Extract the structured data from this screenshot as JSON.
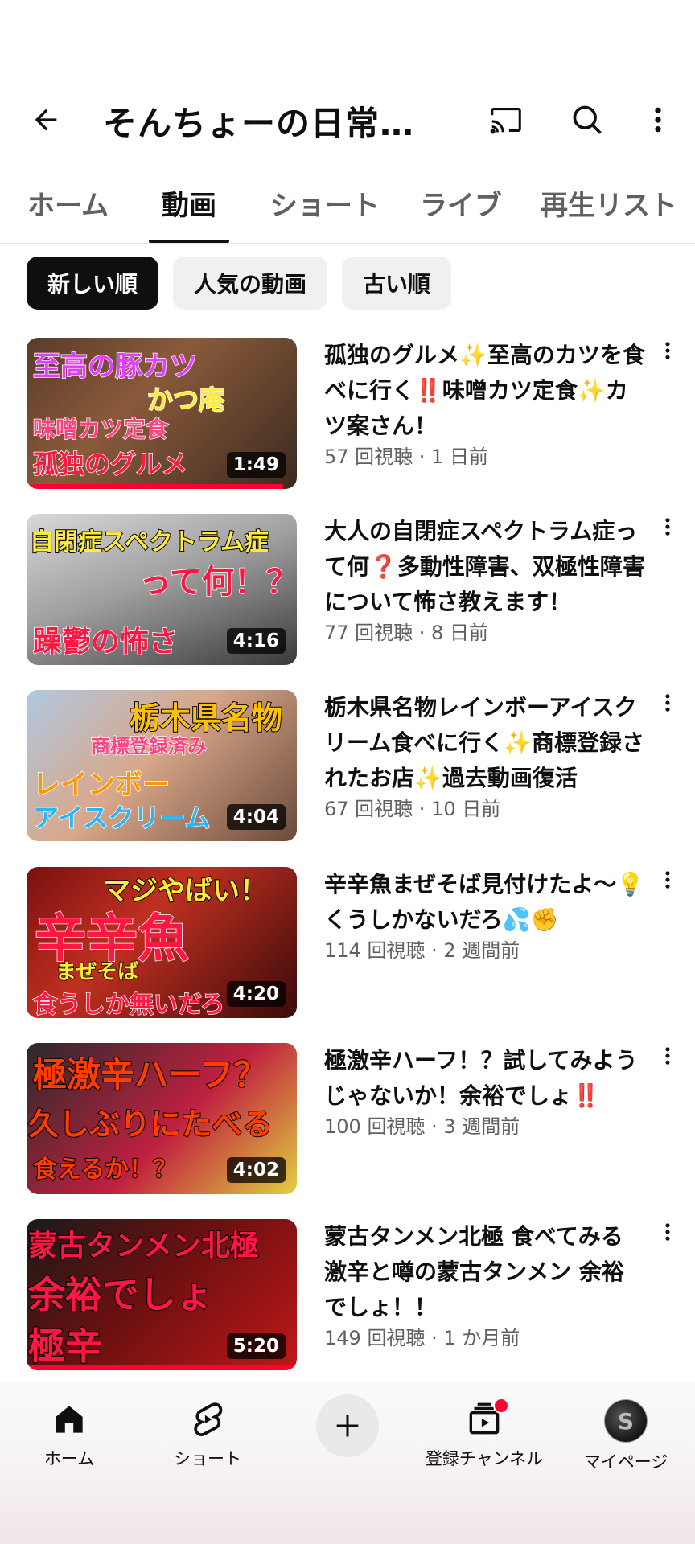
{
  "header": {
    "title": "そんちょーの日常チャンネル",
    "icons": [
      "back-arrow-icon",
      "cast-icon",
      "search-icon",
      "more-vert-icon"
    ]
  },
  "tabs": [
    {
      "label": "ホーム",
      "active": false
    },
    {
      "label": "動画",
      "active": true
    },
    {
      "label": "ショート",
      "active": false
    },
    {
      "label": "ライブ",
      "active": false
    },
    {
      "label": "再生リスト",
      "active": false
    }
  ],
  "chips": [
    {
      "label": "新しい順",
      "active": true
    },
    {
      "label": "人気の動画",
      "active": false
    },
    {
      "label": "古い順",
      "active": false
    }
  ],
  "videos": [
    {
      "title": "孤独のグルメ✨至高のカツを食べに行く‼️味噌カツ定食✨カツ案さん！",
      "meta": "57 回視聴 · 1 日前",
      "duration": "1:49",
      "watched_fraction": 0.95,
      "thumb_lines": [
        "至高の豚カツ",
        "かつ庵",
        "味噌カツ定食",
        "孤独のグルメ"
      ]
    },
    {
      "title": "大人の自閉症スペクトラム症って何❓多動性障害、双極性障害について怖さ教えます！",
      "meta": "77 回視聴 · 8 日前",
      "duration": "4:16",
      "watched_fraction": 0,
      "thumb_lines": [
        "自閉症スペクトラム症",
        "って何！？",
        "躁鬱の怖さ"
      ]
    },
    {
      "title": "栃木県名物レインボーアイスクリーム食べに行く✨商標登録されたお店✨過去動画復活",
      "meta": "67 回視聴 · 10 日前",
      "duration": "4:04",
      "watched_fraction": 0,
      "thumb_lines": [
        "栃木県名物",
        "商標登録済み",
        "レインボー",
        "アイスクリーム"
      ]
    },
    {
      "title": "辛辛魚まぜそば見付けたよ〜💡くうしかないだろ💦✊",
      "meta": "114 回視聴 · 2 週間前",
      "duration": "4:20",
      "watched_fraction": 0,
      "thumb_lines": [
        "マジやばい！",
        "辛辛魚",
        "まぜそば",
        "食うしか無いだろ"
      ]
    },
    {
      "title": "極激辛ハーフ！？試してみようじゃないか！余裕でしょ‼️",
      "meta": "100 回視聴 · 3 週間前",
      "duration": "4:02",
      "watched_fraction": 0,
      "thumb_lines": [
        "極激辛ハーフ？",
        "久しぶりにたべる",
        "食えるか！？"
      ]
    },
    {
      "title": "蒙古タンメン北極 食べてみる 激辛と噂の蒙古タンメン 余裕でしょ！！",
      "meta": "149 回視聴 · 1 か月前",
      "duration": "5:20",
      "watched_fraction": 1,
      "thumb_lines": [
        "蒙古タンメン北極",
        "余裕でしょ",
        "極辛"
      ]
    }
  ],
  "bottom_nav": [
    {
      "label": "ホーム",
      "icon": "home-icon"
    },
    {
      "label": "ショート",
      "icon": "shorts-icon"
    },
    {
      "label": "",
      "icon": "create-plus-icon"
    },
    {
      "label": "登録チャンネル",
      "icon": "subscriptions-icon"
    },
    {
      "label": "マイページ",
      "icon": "avatar"
    }
  ],
  "colors": {
    "accent_red": "#ff0033",
    "text_primary": "#0f0f0f",
    "text_secondary": "#606060",
    "chip_bg": "#f0f0f0"
  }
}
